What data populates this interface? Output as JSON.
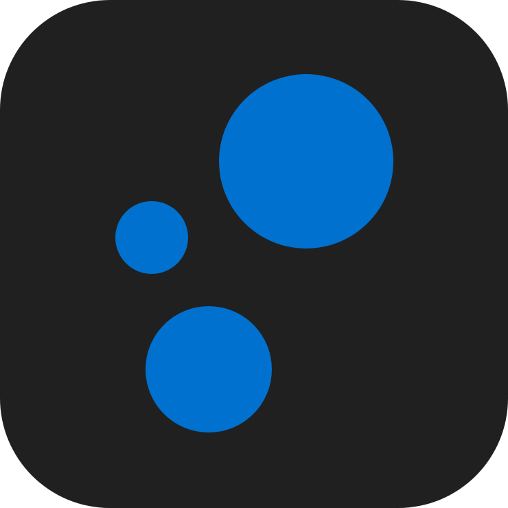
{
  "icon": {
    "name": "three-bubbles-app-icon",
    "background_color": "#202020",
    "dot_color": "#0071CE"
  }
}
